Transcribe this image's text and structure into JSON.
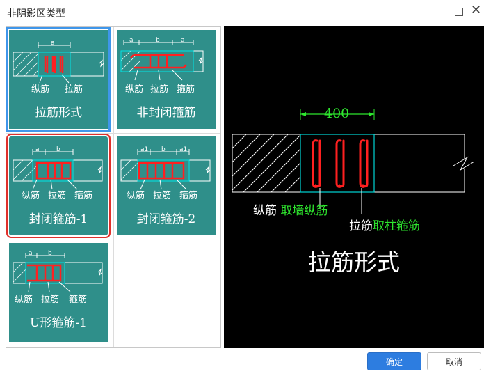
{
  "window": {
    "title": "非阴影区类型"
  },
  "options": [
    {
      "caption": "拉筋形式",
      "labels": [
        "纵筋",
        "拉筋"
      ],
      "dims": [
        "a"
      ]
    },
    {
      "caption": "非封闭箍筋",
      "labels": [
        "纵筋",
        "拉筋",
        "箍筋"
      ],
      "dims": [
        "a",
        "b",
        "a"
      ]
    },
    {
      "caption": "封闭箍筋-1",
      "labels": [
        "纵筋",
        "拉筋",
        "箍筋"
      ],
      "dims": [
        "a",
        "b"
      ]
    },
    {
      "caption": "封闭箍筋-2",
      "labels": [
        "纵筋",
        "拉筋",
        "箍筋"
      ],
      "dims": [
        "a1",
        "b",
        "a1"
      ]
    },
    {
      "caption": "U形箍筋-1",
      "labels": [
        "纵筋",
        "拉筋",
        "箍筋"
      ],
      "dims": [
        "a",
        "b"
      ]
    }
  ],
  "preview": {
    "dimension": "400",
    "label1_white": "纵筋",
    "label1_green": "取墙纵筋",
    "label2_white": "拉筋",
    "label2_green": "取柱箍筋",
    "caption": "拉筋形式"
  },
  "buttons": {
    "ok": "确定",
    "cancel": "取消"
  },
  "colors": {
    "tile": "#2f8f8a",
    "selected_blue": "#3f96ea",
    "selected_red": "#e0312b",
    "rebar": "#ff2020",
    "dim_green": "#2ee62e",
    "primary": "#2d7de0"
  }
}
